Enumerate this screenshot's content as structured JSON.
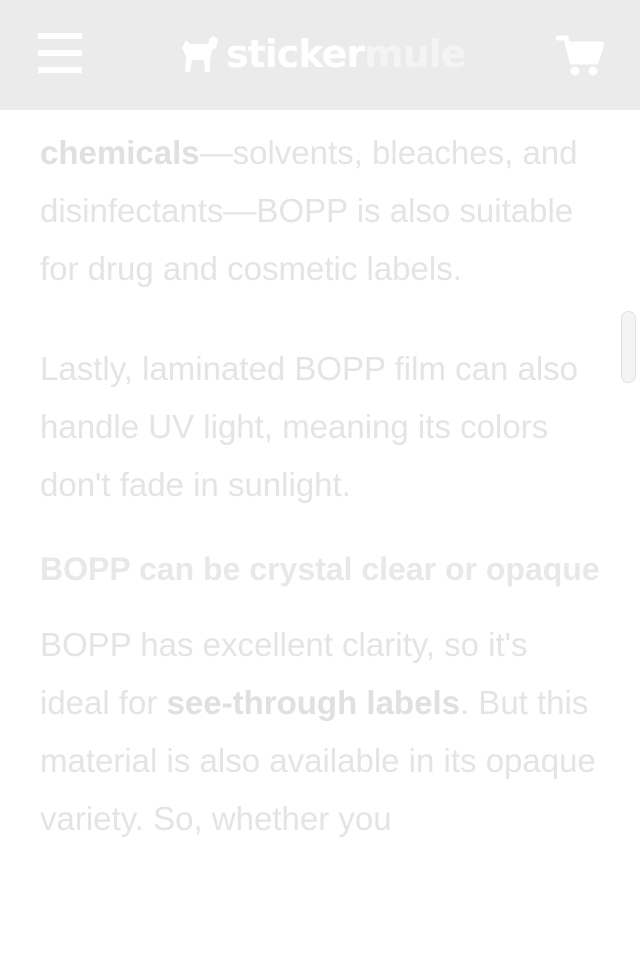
{
  "header": {
    "logo_word1": "sticker",
    "logo_word2": "mule",
    "icons": {
      "menu": "hamburger-menu-icon",
      "logo": "mule-logo-icon",
      "cart": "shopping-cart-icon"
    }
  },
  "article": {
    "p1": {
      "strong": "chemicals",
      "text": "—solvents, bleaches, and disinfectants—BOPP is also suitable for drug and cosmetic labels."
    },
    "p2": "Lastly, laminated BOPP film can also handle UV light, meaning its colors don't fade in sunlight.",
    "heading": "BOPP can be crystal clear or opaque",
    "p3": {
      "before": "BOPP has excellent clarity, so it's ideal for ",
      "link": "see-through labels",
      "after": ". But this material is also available in its opaque variety. So, whether you"
    }
  },
  "colors": {
    "header_bg": "#ebebeb",
    "text": "#e4e4e4",
    "page_bg": "#ffffff"
  }
}
